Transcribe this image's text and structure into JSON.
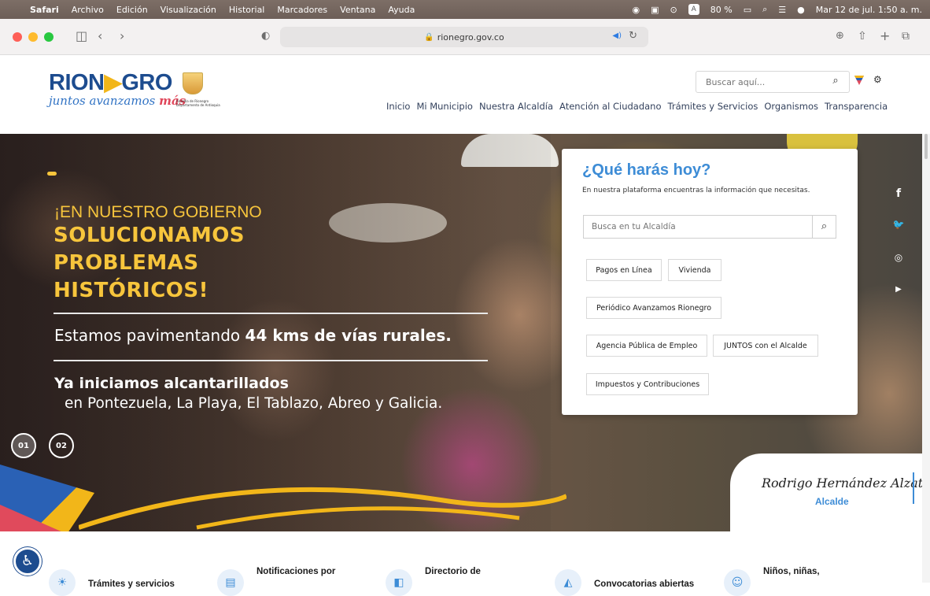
{
  "menubar": {
    "apple": "",
    "items": [
      "Safari",
      "Archivo",
      "Edición",
      "Visualización",
      "Historial",
      "Marcadores",
      "Ventana",
      "Ayuda"
    ],
    "battery": "80 %",
    "datetime": "Mar 12 de jul.  1:50 a. m."
  },
  "browser": {
    "url": "rionegro.gov.co"
  },
  "header": {
    "logo_name_a": "RION",
    "logo_name_tri": "▶",
    "logo_name_b": "GRO",
    "slogan_a": "juntos avanzamos ",
    "slogan_b": "más",
    "shield_text": "Alcaldía de Rionegro Departamento de Antioquia",
    "search_placeholder": "Buscar aquí...",
    "nav": [
      "Inicio",
      "Mi Municipio",
      "Nuestra Alcaldía",
      "Atención al Ciudadano",
      "Trámites y Servicios",
      "Organismos",
      "Transparencia"
    ]
  },
  "hero": {
    "line1": "¡EN NUESTRO GOBIERNO",
    "big1": "SOLUCIONAMOS",
    "big2": "PROBLEMAS",
    "big3": "HISTÓRICOS!",
    "mid_a": "Estamos pavimentando ",
    "mid_b": "44 kms de vías rurales.",
    "low1": "Ya iniciamos alcantarillados",
    "low2": "en Pontezuela, La Playa, El Tablazo, Abreo y Galicia.",
    "slides": [
      "01",
      "02"
    ]
  },
  "card": {
    "title": "¿Qué harás hoy?",
    "subtitle": "En nuestra plataforma encuentras la información que necesitas.",
    "search_placeholder": "Busca en tu Alcaldía",
    "buttons": [
      "Pagos en Línea",
      "Vivienda",
      "Periódico Avanzamos Rionegro",
      "Agencia Pública de Empleo",
      "JUNTOS con el Alcalde",
      "Impuestos y Contribuciones"
    ]
  },
  "social": [
    "f",
    "🐦",
    "◎",
    "▶"
  ],
  "signature": {
    "name": "Rodrigo Hernández Alzate",
    "role": "Alcalde"
  },
  "bottom": {
    "items": [
      "Trámites y servicios",
      "Notificaciones por",
      "Directorio de",
      "Convocatorias abiertas",
      "Niños, niñas,"
    ]
  },
  "colors": {
    "brand_blue": "#1d4c8f",
    "accent_yellow": "#f7c53c",
    "link_blue": "#3d8cd6"
  }
}
